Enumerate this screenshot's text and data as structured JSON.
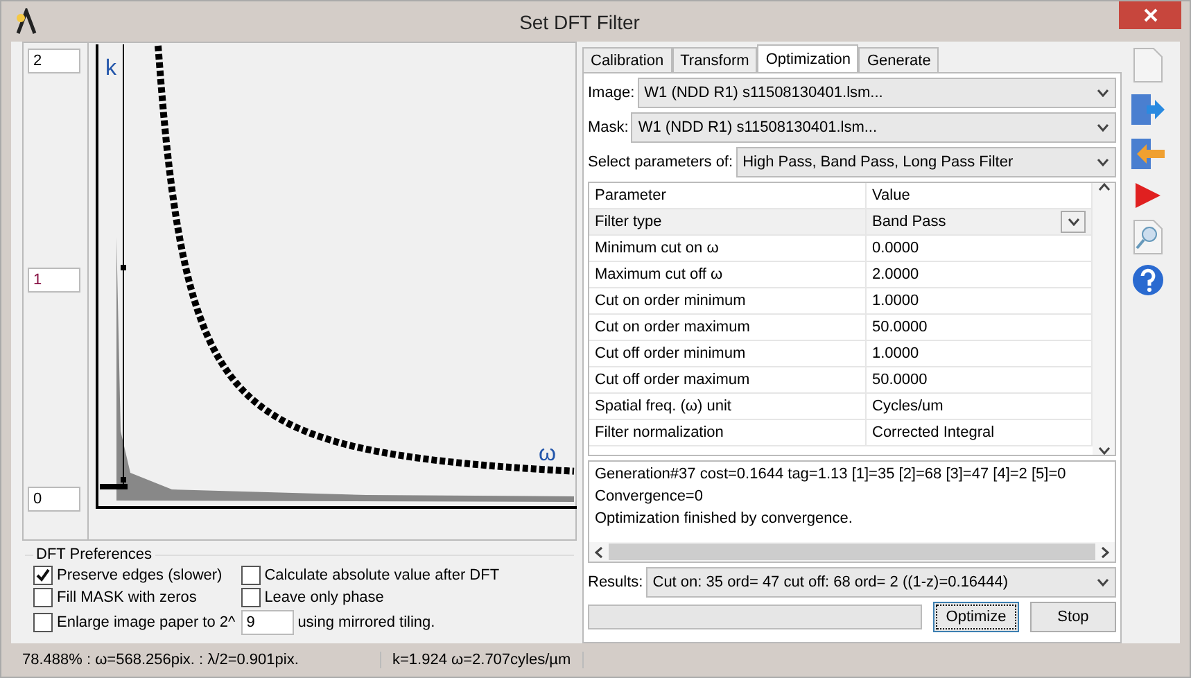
{
  "window": {
    "title": "Set DFT Filter"
  },
  "plot": {
    "scale_fields": [
      "2",
      "1",
      "0"
    ],
    "y_label": "k",
    "x_label": "ω"
  },
  "preferences": {
    "title": "DFT Preferences",
    "options": [
      {
        "label": "Preserve edges (slower)",
        "checked": true
      },
      {
        "label": "Calculate absolute value after DFT",
        "checked": false
      },
      {
        "label": "Fill MASK with zeros",
        "checked": false
      },
      {
        "label": "Leave only phase",
        "checked": false
      },
      {
        "label": "Enlarge image paper to 2^",
        "checked": false
      }
    ],
    "power_value": "9",
    "tiling_label": "using mirrored tiling."
  },
  "tabs": [
    {
      "label": "Calibration",
      "selected": false
    },
    {
      "label": "Transform",
      "selected": false
    },
    {
      "label": "Optimization",
      "selected": true
    },
    {
      "label": "Generate",
      "selected": false
    }
  ],
  "selectors": [
    {
      "label": "Image:",
      "value": "W1 (NDD R1) s11508130401.lsm..."
    },
    {
      "label": "Mask:",
      "value": "W1 (NDD R1) s11508130401.lsm..."
    },
    {
      "label": "Select parameters of:",
      "value": "High Pass, Band Pass, Long Pass Filter"
    }
  ],
  "table": {
    "columns": [
      "Parameter",
      "Value"
    ],
    "rows": [
      {
        "parameter": "Filter type",
        "value": "Band Pass",
        "kind": "dropdown",
        "selected": true
      },
      {
        "parameter": "Minimum cut on ω",
        "value": "0.0000",
        "kind": "text",
        "selected": false
      },
      {
        "parameter": "Maximum cut off ω",
        "value": "2.0000",
        "kind": "text",
        "selected": false
      },
      {
        "parameter": "Cut on order minimum",
        "value": "1.0000",
        "kind": "text",
        "selected": false
      },
      {
        "parameter": "Cut on order maximum",
        "value": "50.0000",
        "kind": "text",
        "selected": false
      },
      {
        "parameter": "Cut off order minimum",
        "value": "1.0000",
        "kind": "text",
        "selected": false
      },
      {
        "parameter": "Cut off order maximum",
        "value": "50.0000",
        "kind": "text",
        "selected": false
      },
      {
        "parameter": "Spatial freq. (ω) unit",
        "value": "Cycles/um",
        "kind": "text",
        "selected": false
      },
      {
        "parameter": "Filter normalization",
        "value": "Corrected Integral",
        "kind": "text",
        "selected": false
      }
    ]
  },
  "log": [
    "Generation#37 cost=0.1644 tag=1.13 [1]=35 [2]=68 [3]=47 [4]=2 [5]=0",
    "Convergence=0",
    "Optimization finished by convergence."
  ],
  "results": {
    "label": "Results:",
    "value": "Cut on: 35 ord= 47 cut off: 68 ord= 2 ((1-z)=0.16444)"
  },
  "progress": {
    "level": 0
  },
  "buttons": [
    {
      "label": "Optimize",
      "focused": true
    },
    {
      "label": "Stop",
      "focused": false
    }
  ],
  "status_bar": [
    "78.488% : ω=568.256pix. : λ/2=0.901pix.",
    "k=1.924 ω=2.707cyles/µm"
  ]
}
